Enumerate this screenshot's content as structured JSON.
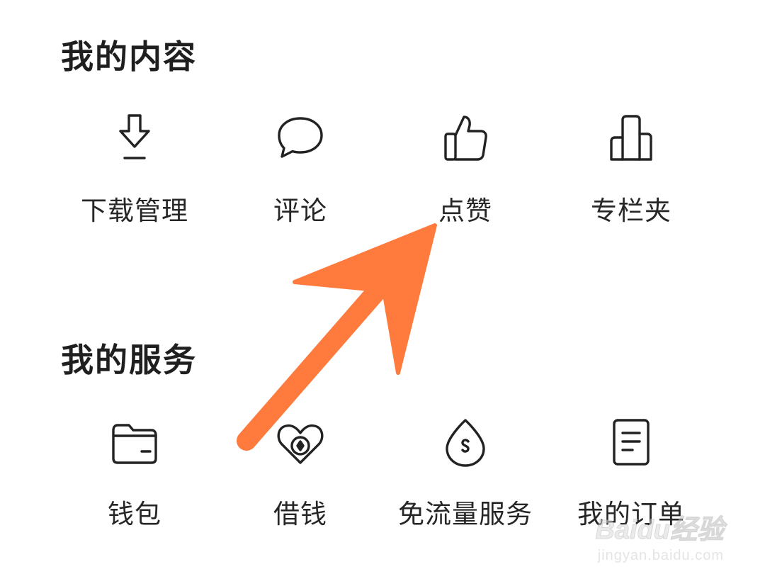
{
  "sections": {
    "content": {
      "title": "我的内容",
      "items": [
        {
          "label": "下载管理",
          "icon": "download-icon"
        },
        {
          "label": "评论",
          "icon": "comment-icon"
        },
        {
          "label": "点赞",
          "icon": "thumbs-up-icon"
        },
        {
          "label": "专栏夹",
          "icon": "bar-chart-icon"
        }
      ]
    },
    "services": {
      "title": "我的服务",
      "items": [
        {
          "label": "钱包",
          "icon": "wallet-icon"
        },
        {
          "label": "借钱",
          "icon": "heart-coin-icon"
        },
        {
          "label": "免流量服务",
          "icon": "water-drop-icon"
        },
        {
          "label": "我的订单",
          "icon": "order-list-icon"
        }
      ]
    }
  },
  "annotation": {
    "arrow_color": "#FF7A3D",
    "arrow_points_to": "点赞"
  },
  "watermark": {
    "brand": "Baidu经验",
    "url": "jingyan.baidu.com"
  },
  "colors": {
    "background": "#ffffff",
    "text": "#222222",
    "accent_arrow": "#FF7A3D"
  }
}
